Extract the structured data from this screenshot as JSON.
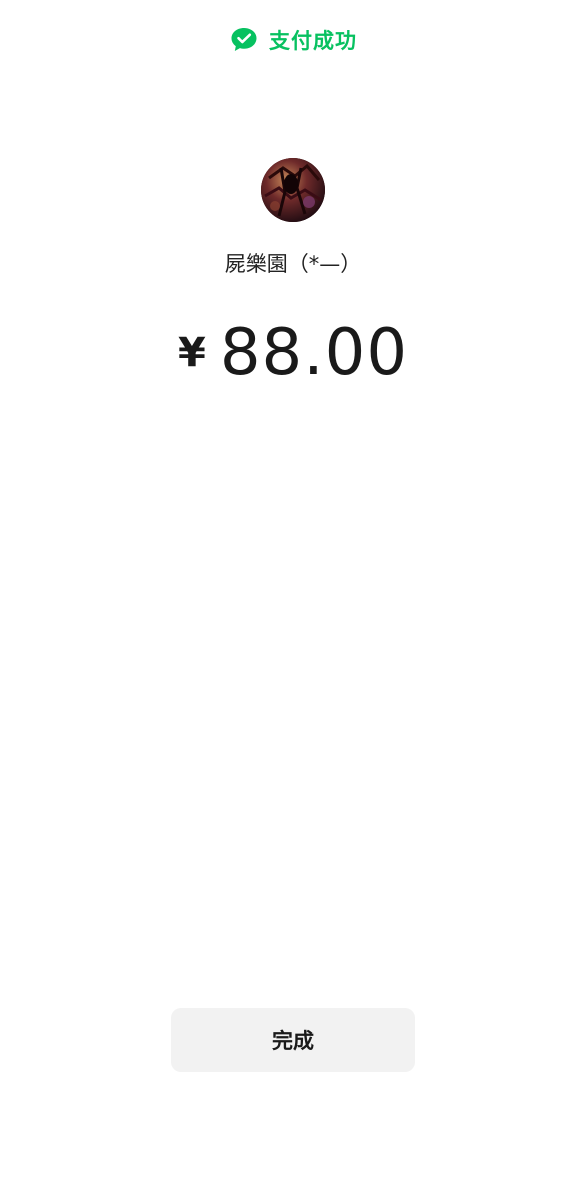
{
  "header": {
    "icon": "wechat-pay-check-icon",
    "status_text": "支付成功",
    "accent_color": "#07c160"
  },
  "payee": {
    "avatar_icon": "payee-avatar",
    "name": "屍樂園（*—）"
  },
  "amount": {
    "currency_symbol": "¥",
    "value": "88.00"
  },
  "actions": {
    "done_label": "完成"
  }
}
